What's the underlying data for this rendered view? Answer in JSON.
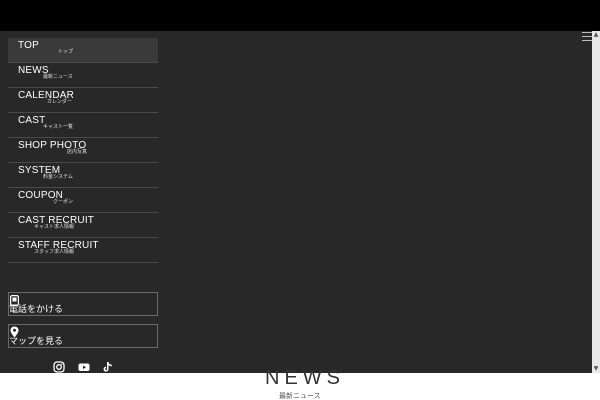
{
  "menu": [
    {
      "en": "TOP",
      "jp": "トップ"
    },
    {
      "en": "NEWS",
      "jp": "最新ニュース"
    },
    {
      "en": "CALENDAR",
      "jp": "カレンダー"
    },
    {
      "en": "CAST",
      "jp": "キャスト一覧"
    },
    {
      "en": "SHOP PHOTO",
      "jp": "店内写真"
    },
    {
      "en": "SYSTEM",
      "jp": "料金システム"
    },
    {
      "en": "COUPON",
      "jp": "クーポン"
    },
    {
      "en": "CAST RECRUIT",
      "jp": "キャスト求人情報"
    },
    {
      "en": "STAFF RECRUIT",
      "jp": "スタッフ求人情報"
    }
  ],
  "actions": {
    "call_label": "電話をかける",
    "map_label": "マップを見る"
  },
  "social": {
    "icons": [
      "instagram-icon",
      "youtube-icon",
      "tiktok-icon"
    ]
  },
  "section": {
    "title": "NEWS",
    "subtitle": "最新ニュース"
  },
  "colors": {
    "topbar": "#000000",
    "overlay": "#282828",
    "text": "#ffffff"
  }
}
